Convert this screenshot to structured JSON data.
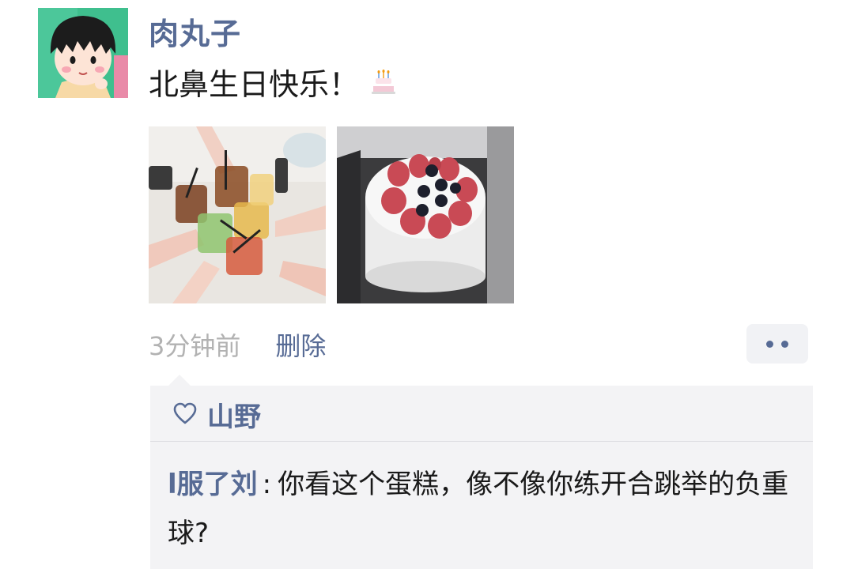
{
  "post": {
    "author": "肉丸子",
    "text": "北鼻生日快乐！",
    "emoji": "birthday-cake-emoji",
    "photos": [
      {
        "name": "drinks-toast-photo"
      },
      {
        "name": "strawberry-cake-photo"
      }
    ],
    "time": "3分钟前",
    "delete_label": "删除"
  },
  "likes": {
    "icon": "heart-icon",
    "names": "山野"
  },
  "comment": {
    "author": "l服了刘",
    "separator": ":",
    "text": "你看这个蛋糕，像不像你练开合跳举的负重球?"
  },
  "colors": {
    "link": "#576b95",
    "muted": "#b2b2b2",
    "comment_bg": "#f3f3f5"
  }
}
